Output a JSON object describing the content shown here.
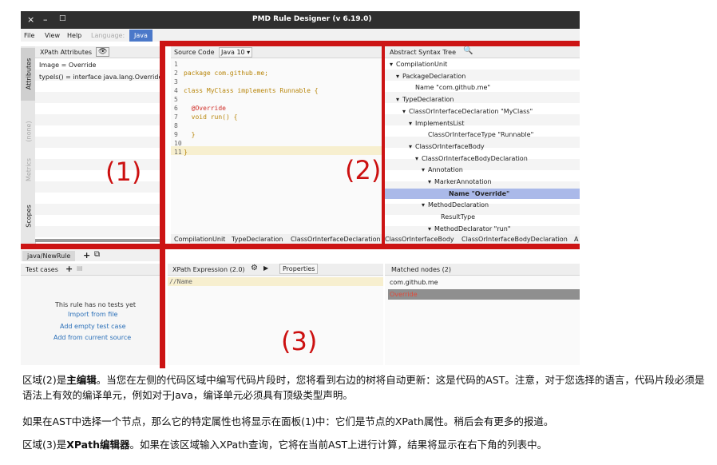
{
  "window": {
    "title": "PMD Rule Designer (v 6.19.0)",
    "controls": [
      "×",
      "–",
      "□"
    ]
  },
  "menubar": {
    "items": [
      "File",
      "View",
      "Help"
    ],
    "language_label": "Language:",
    "language_value": "Java"
  },
  "left_panel": {
    "header": "XPath Attributes",
    "side_tabs": [
      "Attributes",
      "(none)",
      "Metrics",
      "Scopes"
    ],
    "attributes": [
      "Image = Override",
      "typeIs() = interface java.lang.Override"
    ]
  },
  "editor": {
    "header": "Source Code",
    "version": "Java 10",
    "lines": [
      {
        "n": "1",
        "t": ""
      },
      {
        "n": "2",
        "t": "package com.github.me;"
      },
      {
        "n": "3",
        "t": ""
      },
      {
        "n": "4",
        "t": "class MyClass implements Runnable {"
      },
      {
        "n": "5",
        "t": ""
      },
      {
        "n": "6",
        "t": "  @Override"
      },
      {
        "n": "7",
        "t": "  void run() {"
      },
      {
        "n": "8",
        "t": ""
      },
      {
        "n": "9",
        "t": "  }"
      },
      {
        "n": "10",
        "t": ""
      },
      {
        "n": "11",
        "t": "}"
      }
    ],
    "breadcrumbs": [
      "CompilationUnit",
      "TypeDeclaration",
      "ClassOrInterfaceDeclaration",
      "ClassOrInterfaceBody",
      "ClassOrInterfaceBodyDeclaration",
      "A"
    ]
  },
  "ast": {
    "header": "Abstract Syntax Tree",
    "nodes": [
      {
        "label": "CompilationUnit",
        "arrow": "▾"
      },
      {
        "label": "PackageDeclaration",
        "arrow": "▾"
      },
      {
        "label": "Name \"com.github.me\"",
        "arrow": ""
      },
      {
        "label": "TypeDeclaration",
        "arrow": "▾"
      },
      {
        "label": "ClassOrInterfaceDeclaration \"MyClass\"",
        "arrow": "▾"
      },
      {
        "label": "ImplementsList",
        "arrow": "▾"
      },
      {
        "label": "ClassOrInterfaceType \"Runnable\"",
        "arrow": ""
      },
      {
        "label": "ClassOrInterfaceBody",
        "arrow": "▾"
      },
      {
        "label": "ClassOrInterfaceBodyDeclaration",
        "arrow": "▾"
      },
      {
        "label": "Annotation",
        "arrow": "▾"
      },
      {
        "label": "MarkerAnnotation",
        "arrow": "▾"
      },
      {
        "label": "Name \"Override\"",
        "arrow": ""
      },
      {
        "label": "MethodDeclaration",
        "arrow": "▾"
      },
      {
        "label": "ResultType",
        "arrow": ""
      },
      {
        "label": "MethodDeclarator \"run\"",
        "arrow": "▾"
      }
    ]
  },
  "tests": {
    "tab": "java/NewRule",
    "header": "Test cases",
    "empty": "This rule has no tests yet",
    "links": [
      "Import from file",
      "Add empty test case",
      "Add from current source"
    ]
  },
  "xpath": {
    "header": "XPath Expression (2.0)",
    "properties": "Properties",
    "value": "//Name"
  },
  "matched": {
    "header": "Matched nodes (2)",
    "items": [
      "com.github.me",
      "Override"
    ]
  },
  "overlay": {
    "label1": "(1)",
    "label2": "(2)",
    "label3": "(3)"
  },
  "text": {
    "p1_a": "区域(2)是",
    "p1_b": "主编辑",
    "p1_c": "。当您在左侧的代码区域中编写代码片段时，您将看到右边的树将自动更新：这是代码的AST。注意，对于您选择的语言，代码片段必须是语法上有效的编译单元，例如对于Java，编译单元必须具有顶级类型声明。",
    "p2": "如果在AST中选择一个节点，那么它的特定属性也将显示在面板(1)中：它们是节点的XPath属性。稍后会有更多的报道。",
    "p3_a": "区域(3)是",
    "p3_b": "XPath编辑器",
    "p3_c": "。如果在该区域输入XPath查询，它将在当前AST上进行计算，结果将显示在右下角的列表中。"
  }
}
